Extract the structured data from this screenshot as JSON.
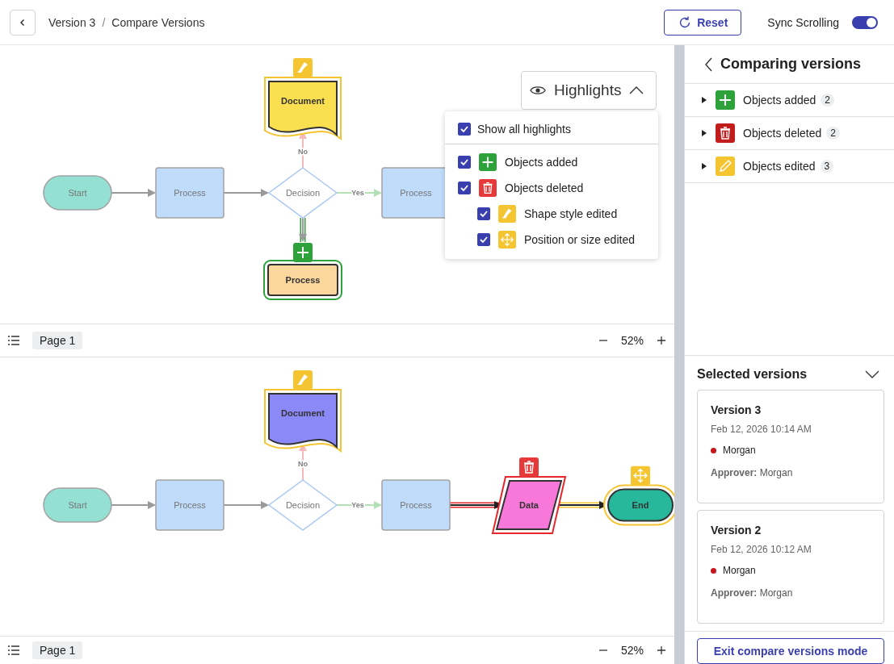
{
  "header": {
    "breadcrumb": {
      "items": [
        "Version 3",
        "Compare Versions"
      ],
      "separator": "/"
    },
    "reset_button": "Reset",
    "sync_scrolling": {
      "label": "Sync Scrolling",
      "on": true
    }
  },
  "canvases": [
    {
      "nodes": [
        {
          "kind": "document",
          "label": "Document",
          "color": "#fadf50",
          "highlight": {
            "kind": "style"
          }
        },
        {
          "kind": "terminator",
          "label": "Start",
          "color": "#94e1d4"
        },
        {
          "kind": "process",
          "label": "Process",
          "color": "#c0dcfb"
        },
        {
          "kind": "decision",
          "label": "Decision",
          "color": "#ffffff"
        },
        {
          "kind": "process",
          "label": "Process",
          "color": "#c0dcfb"
        },
        {
          "kind": "process",
          "label": "Process",
          "color": "#fbd79d",
          "highlight": {
            "kind": "added"
          }
        }
      ],
      "edges": [
        {
          "color": "#9a9a9a"
        },
        {
          "color": "#9a9a9a"
        },
        {
          "color": "#b3e0b5",
          "label": "Yes"
        },
        {
          "color": "#f6b9b9",
          "label": "No"
        },
        {
          "color": "#9a9a9a",
          "highlight": {
            "kind": "added"
          }
        }
      ],
      "page_bar": {
        "page": "Page 1",
        "zoom": "52%"
      }
    },
    {
      "nodes": [
        {
          "kind": "document",
          "label": "Document",
          "color": "#8b88f8",
          "highlight": {
            "kind": "style"
          }
        },
        {
          "kind": "terminator",
          "label": "Start",
          "color": "#94e1d4"
        },
        {
          "kind": "process",
          "label": "Process",
          "color": "#c0dcfb"
        },
        {
          "kind": "decision",
          "label": "Decision",
          "color": "#ffffff"
        },
        {
          "kind": "process",
          "label": "Process",
          "color": "#c0dcfb"
        },
        {
          "kind": "data",
          "label": "Data",
          "color": "#f778d8",
          "highlight": {
            "kind": "deleted"
          }
        },
        {
          "kind": "terminator",
          "label": "End",
          "color": "#27b79b",
          "highlight": {
            "kind": "position"
          }
        }
      ],
      "edges": [
        {
          "color": "#9a9a9a"
        },
        {
          "color": "#9a9a9a"
        },
        {
          "color": "#b3e0b5",
          "label": "Yes"
        },
        {
          "color": "#f6b9b9",
          "label": "No"
        },
        {
          "color": "#222222",
          "highlight": {
            "kind": "deleted"
          }
        },
        {
          "color": "#222222",
          "highlight": {
            "kind": "position"
          }
        }
      ],
      "page_bar": {
        "page": "Page 1",
        "zoom": "52%"
      }
    }
  ],
  "highlights": {
    "label": "Highlights",
    "expanded": true,
    "show_all": {
      "label": "Show all highlights",
      "checked": true
    },
    "options": [
      {
        "kind": "added",
        "label": "Objects added",
        "checked": true
      },
      {
        "kind": "deleted",
        "label": "Objects deleted",
        "checked": true,
        "children": [
          {
            "kind": "style",
            "label": "Shape style edited",
            "checked": true
          },
          {
            "kind": "position",
            "label": "Position or size edited",
            "checked": true
          }
        ]
      }
    ]
  },
  "sidebar": {
    "title": "Comparing versions",
    "categories": [
      {
        "kind": "added",
        "label": "Objects added",
        "count": "2",
        "expanded": false
      },
      {
        "kind": "deleted",
        "label": "Objects deleted",
        "count": "2",
        "expanded": false
      },
      {
        "kind": "edited",
        "label": "Objects edited",
        "count": "3",
        "expanded": false
      }
    ],
    "selected_versions": {
      "title": "Selected versions",
      "versions": [
        {
          "title": "Version 3",
          "date": "Feb 12, 2026 10:14 AM",
          "author": "Morgan",
          "color": "#c8161d",
          "approver": "**Approver:** Morgan"
        },
        {
          "title": "Version 2",
          "date": "Feb 12, 2026 10:12 AM",
          "author": "Morgan",
          "color": "#c8161d",
          "approver": "**Approver:** Morgan"
        }
      ]
    },
    "exit_button": "Exit compare versions mode"
  }
}
